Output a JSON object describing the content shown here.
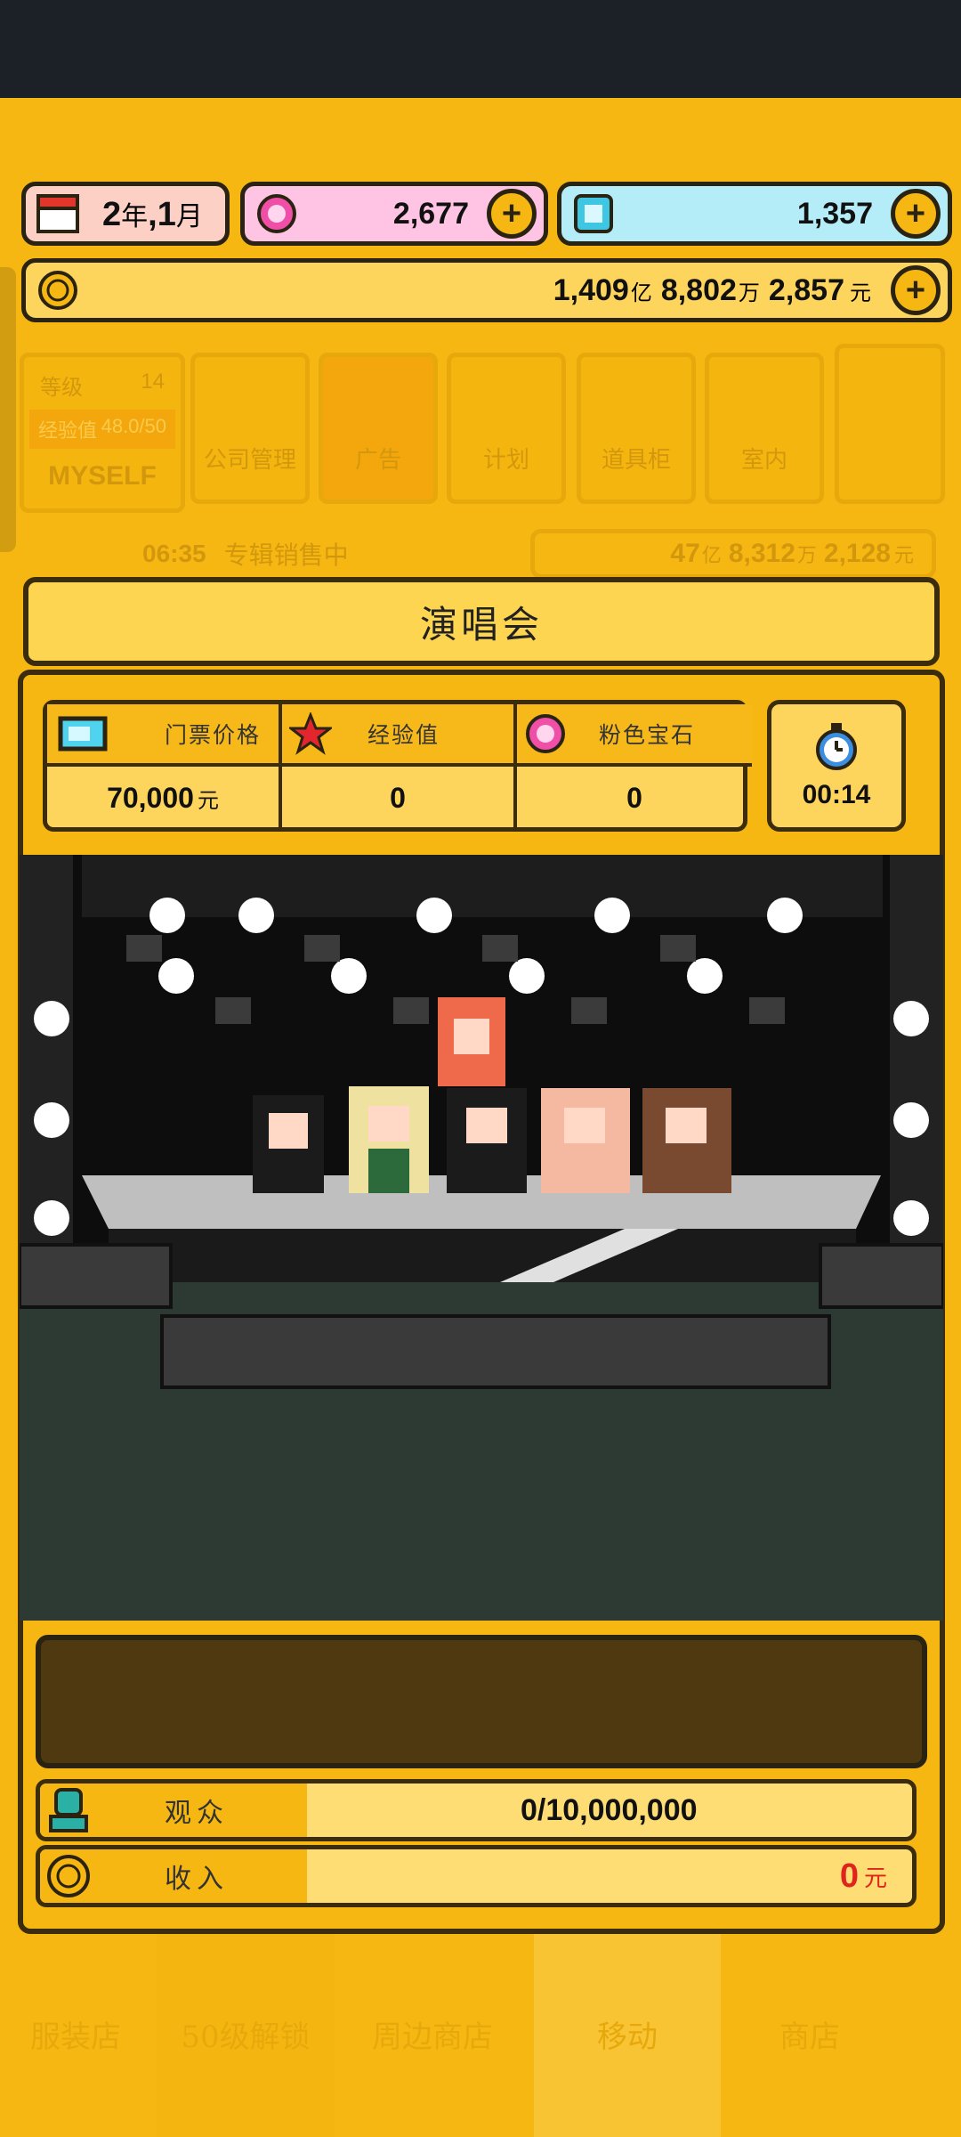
{
  "top_bar": {
    "date": {
      "year": "2",
      "year_unit": "年",
      "sep": ",",
      "month": "1",
      "month_unit": "月"
    },
    "pink_gems": "2,677",
    "blue_gems": "1,357",
    "money": {
      "yi": "1,409",
      "yi_unit": "亿",
      "wan": "8,802",
      "wan_unit": "万",
      "yuan": "2,857",
      "yuan_unit": "元"
    }
  },
  "background_hud": {
    "level_label": "等级",
    "level_value": "14",
    "exp_label": "经验值",
    "exp_value": "48.0/50",
    "company_name": "MYSELF",
    "menu": [
      "公司管理",
      "广告",
      "计划",
      "道具柜",
      "室内"
    ],
    "activity_time": "06:35",
    "activity_text": "专辑销售中",
    "money": {
      "yi": "47",
      "yi_unit": "亿",
      "wan": "8,312",
      "wan_unit": "万",
      "yuan": "2,128",
      "yuan_unit": "元"
    },
    "bottom_tabs": [
      "服装店",
      "50级解锁",
      "周边商店",
      "移动",
      "商店"
    ]
  },
  "modal": {
    "title": "演唱会",
    "stats": [
      {
        "label": "门票价格",
        "value": "70,000",
        "unit": "元",
        "icon": "ticket-icon"
      },
      {
        "label": "经验值",
        "value": "0",
        "unit": "",
        "icon": "star-icon"
      },
      {
        "label": "粉色宝石",
        "value": "0",
        "unit": "",
        "icon": "pink-gem-icon"
      }
    ],
    "timer": "00:14",
    "audience_label": "观众",
    "audience_value": "0/10,000,000",
    "income_label": "收入",
    "income_value": "0",
    "income_unit": "元"
  },
  "colors": {
    "background": "#f6b712",
    "panel_light": "#fdd55c",
    "border": "#3a2c0c",
    "income_red": "#e0231c",
    "pink_pill": "#ffc4e3",
    "blue_pill": "#b4ecf7"
  }
}
